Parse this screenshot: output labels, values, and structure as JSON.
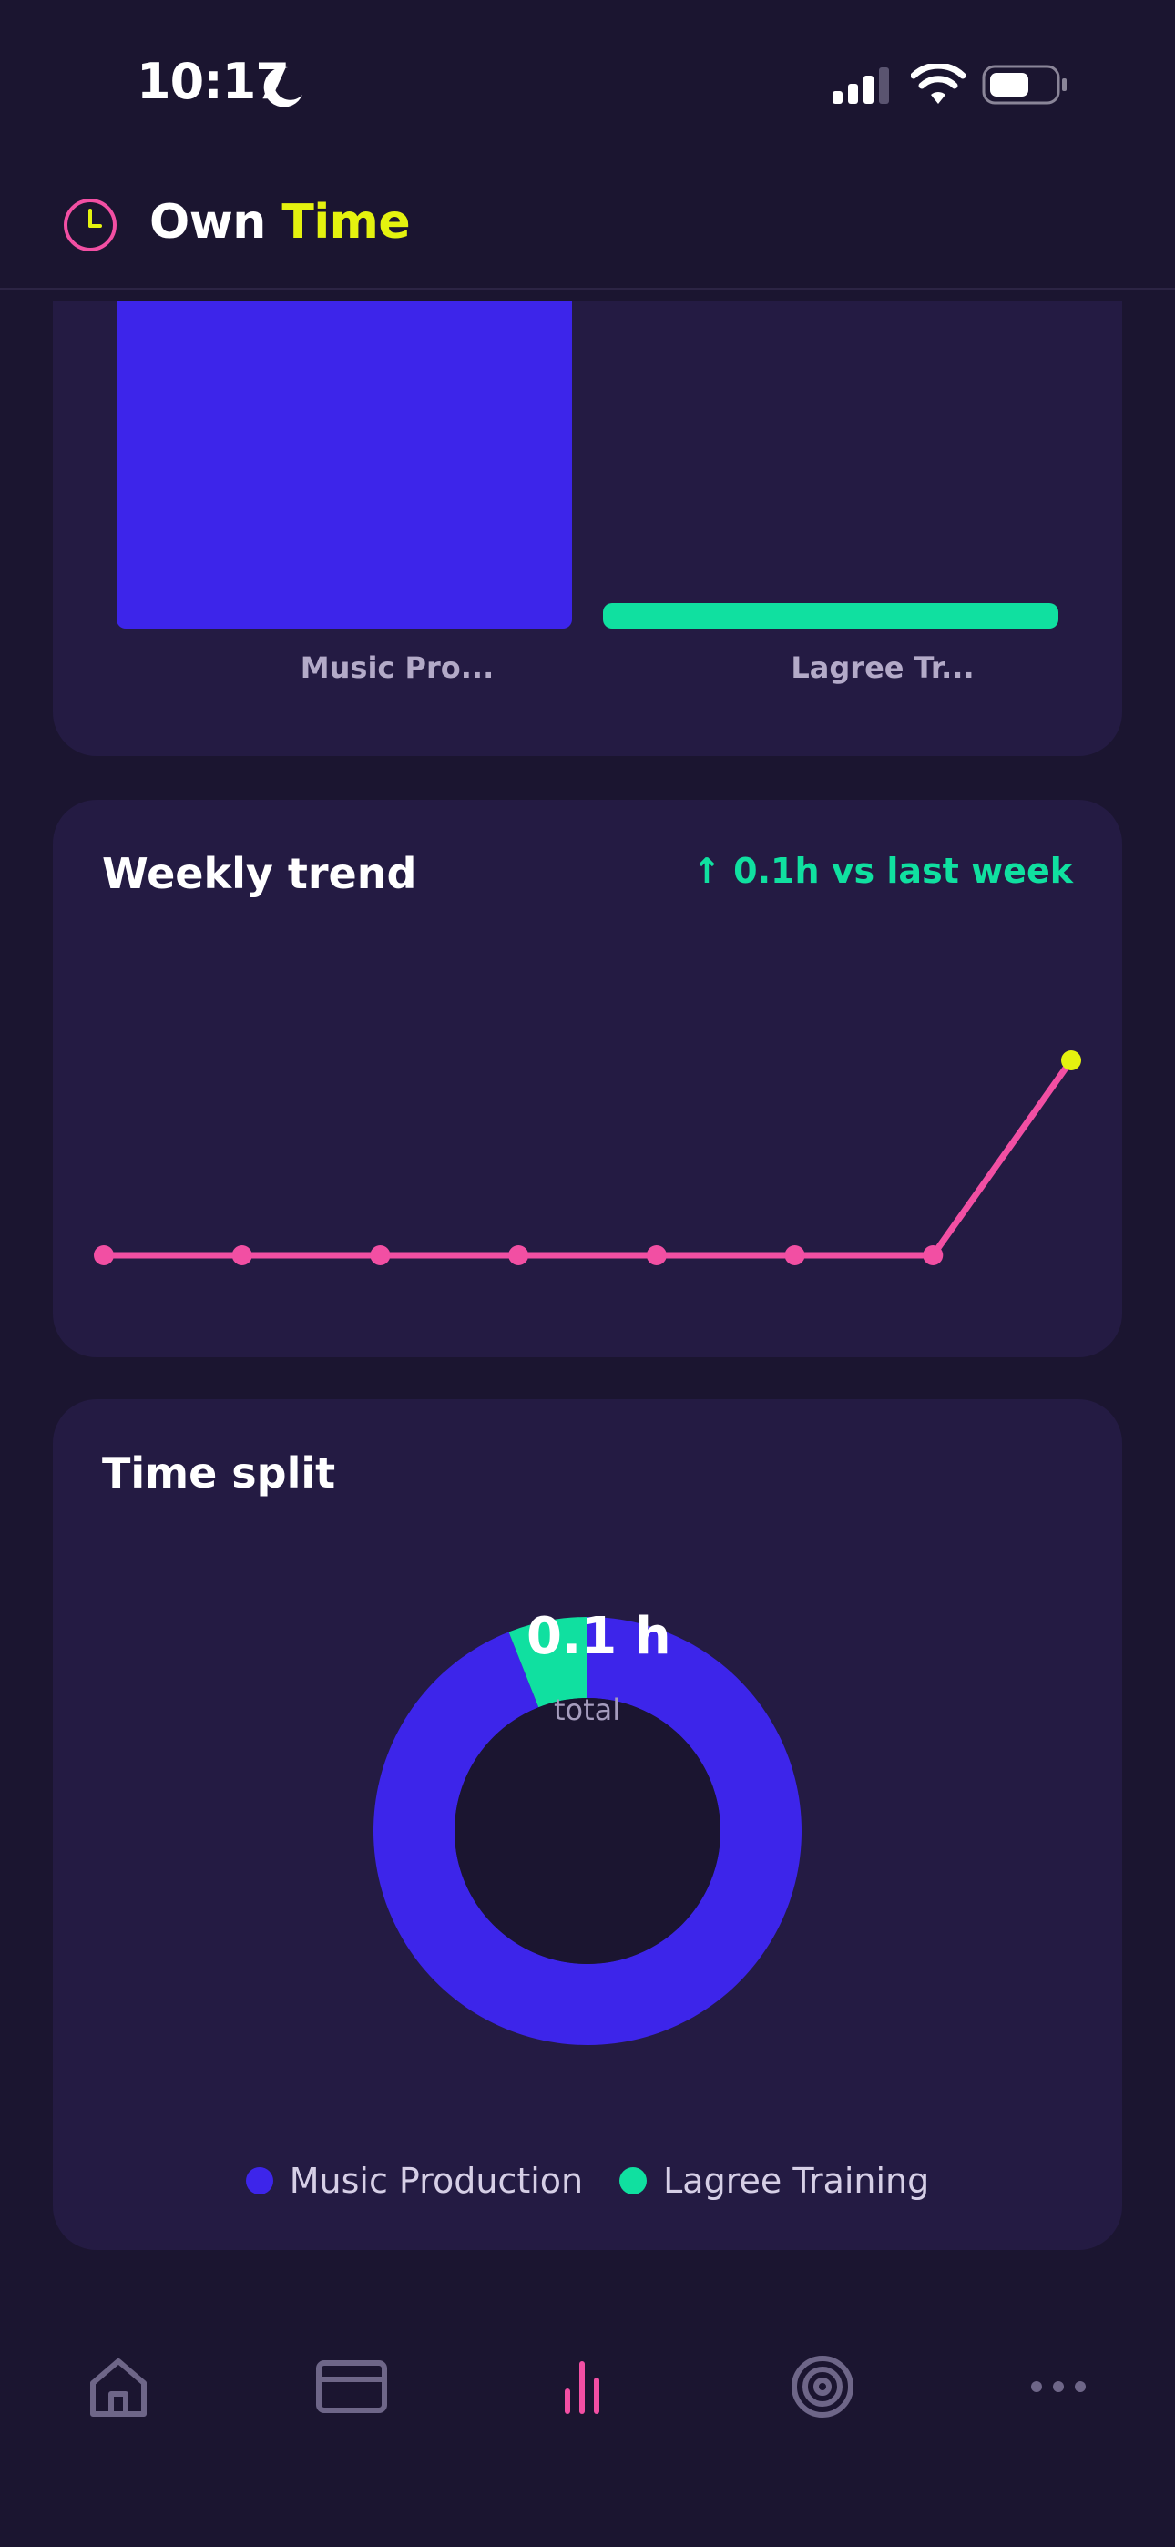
{
  "status_bar": {
    "time": "10:17"
  },
  "header": {
    "title_part1": "Own",
    "title_part2": "Time",
    "logo_icon": "clock-icon"
  },
  "bar_card": {
    "categories": [
      "Music Pro...",
      "Lagree Tr..."
    ],
    "colors": [
      "#3d25ea",
      "#10e0a0"
    ]
  },
  "trend_card": {
    "title": "Weekly trend",
    "delta": "↑ 0.1h vs last week",
    "line_color": "#f24fa3",
    "highlight_color": "#e4f20f"
  },
  "split_card": {
    "title": "Time split",
    "total_value": "0.1 h",
    "total_label": "total",
    "legend": [
      {
        "label": "Music Production",
        "color": "#3d25ea"
      },
      {
        "label": "Lagree Training",
        "color": "#10e0a0"
      }
    ]
  },
  "chart_data": [
    {
      "type": "bar",
      "categories": [
        "Music Pro...",
        "Lagree Tr..."
      ],
      "values": [
        0.1,
        0.005
      ]
    },
    {
      "type": "line",
      "title": "Weekly trend",
      "x": [
        1,
        2,
        3,
        4,
        5,
        6,
        7,
        8
      ],
      "values": [
        0,
        0,
        0,
        0,
        0,
        0,
        0,
        0.1
      ]
    },
    {
      "type": "pie",
      "title": "Time split",
      "categories": [
        "Music Production",
        "Lagree Training"
      ],
      "values": [
        94,
        6
      ]
    }
  ],
  "tab_bar": {
    "tabs": [
      {
        "icon": "home-icon",
        "active": false
      },
      {
        "icon": "card-icon",
        "active": false
      },
      {
        "icon": "bar-chart-icon",
        "active": true
      },
      {
        "icon": "target-icon",
        "active": false
      },
      {
        "icon": "more-icon",
        "active": false
      }
    ],
    "active_color": "#f24fa3",
    "inactive_color": "#6e6688"
  }
}
